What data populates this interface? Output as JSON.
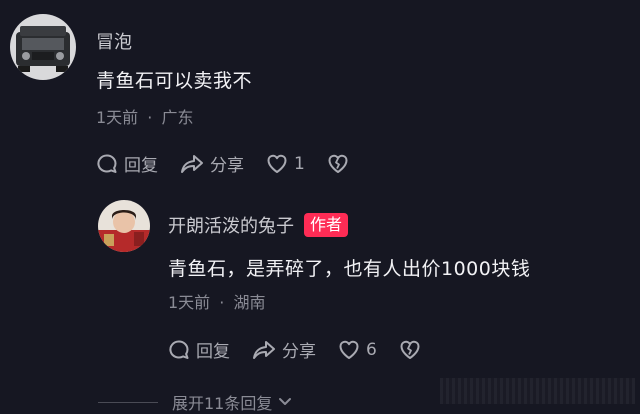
{
  "comment1": {
    "username": "冒泡",
    "text": "青鱼石可以卖我不",
    "time": "1天前",
    "location": "广东",
    "reply_label": "回复",
    "share_label": "分享",
    "like_count": "1"
  },
  "comment2": {
    "username": "开朗活泼的兔子",
    "author_badge": "作者",
    "text": "青鱼石，是弄碎了，也有人出价1000块钱",
    "time": "1天前",
    "location": "湖南",
    "reply_label": "回复",
    "share_label": "分享",
    "like_count": "6"
  },
  "expand_replies": "展开11条回复",
  "separator": "·",
  "icons": {
    "reply": "speech-bubble-icon",
    "share": "share-arrow-icon",
    "like": "heart-outline-icon",
    "dislike": "broken-heart-icon",
    "expand": "chevron-down-icon"
  },
  "colors": {
    "background": "#161722",
    "author_badge": "#fe2c55",
    "meta_text": "#8a8b95"
  }
}
